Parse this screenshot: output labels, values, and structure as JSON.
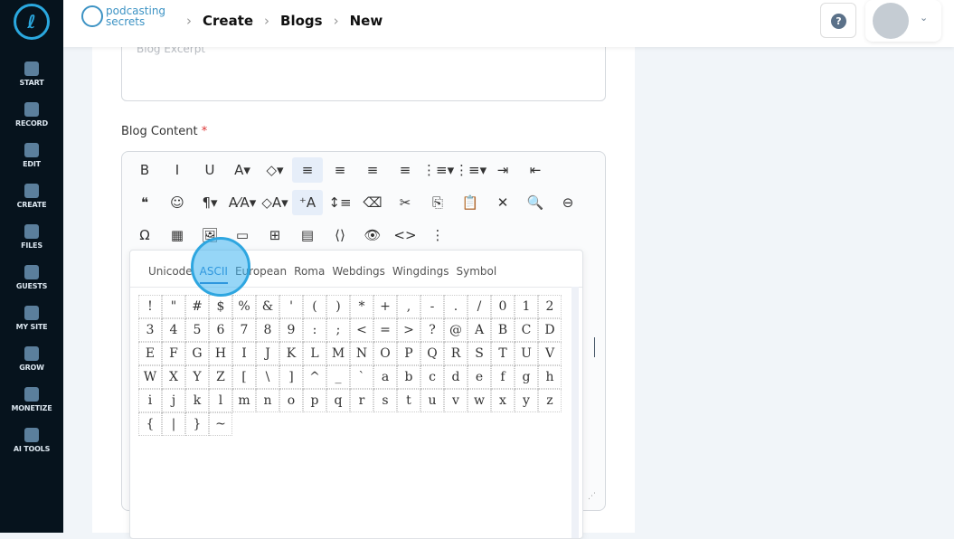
{
  "sidebar": {
    "items": [
      {
        "label": "START"
      },
      {
        "label": "RECORD"
      },
      {
        "label": "EDIT"
      },
      {
        "label": "CREATE"
      },
      {
        "label": "FILES"
      },
      {
        "label": "GUESTS"
      },
      {
        "label": "MY SITE"
      },
      {
        "label": "GROW"
      },
      {
        "label": "MONETIZE"
      },
      {
        "label": "AI TOOLS"
      }
    ]
  },
  "header": {
    "brand_line1": "podcasting",
    "brand_line2": "secrets",
    "breadcrumb": [
      "Create",
      "Blogs",
      "New"
    ],
    "help": "?"
  },
  "form": {
    "excerpt_placeholder": "Blog Excerpt",
    "content_label": "Blog Content",
    "required": "*"
  },
  "toolbar": {
    "row1": [
      "B",
      "I",
      "U",
      "A▾",
      "◇▾",
      "≡",
      "≡",
      "≡",
      "≡",
      "⋮≡▾",
      "⋮≡▾",
      "⇥",
      "⇤"
    ],
    "row2": [
      "❝",
      "☺",
      "¶▾",
      "A⁄A▾",
      "◇A▾",
      "⁺A",
      "↕≡",
      "⌫",
      "✂",
      "⎘",
      "📋",
      "✕",
      "🔍",
      "⊖"
    ],
    "row3": [
      "Ω",
      "▦",
      "🖼",
      "▭",
      "⊞",
      "▤",
      "⟨⟩",
      "👁",
      "<>",
      "⋮"
    ]
  },
  "charmap": {
    "tabs": [
      "Unicode",
      "ASCII",
      "European",
      "Roma",
      "Webdings",
      "Wingdings",
      "Symbol"
    ],
    "active_tab": "ASCII",
    "chars": [
      "!",
      "\"",
      "#",
      "$",
      "%",
      "&",
      "'",
      "(",
      ")",
      "*",
      "+",
      ",",
      "-",
      ".",
      "/",
      "0",
      "1",
      "2",
      "3",
      "4",
      "5",
      "6",
      "7",
      "8",
      "9",
      ":",
      ";",
      "<",
      "=",
      ">",
      "?",
      "@",
      "A",
      "B",
      "C",
      "D",
      "E",
      "F",
      "G",
      "H",
      "I",
      "J",
      "K",
      "L",
      "M",
      "N",
      "O",
      "P",
      "Q",
      "R",
      "S",
      "T",
      "U",
      "V",
      "W",
      "X",
      "Y",
      "Z",
      "[",
      "\\",
      "]",
      "^",
      "_",
      "`",
      "a",
      "b",
      "c",
      "d",
      "e",
      "f",
      "g",
      "h",
      "i",
      "j",
      "k",
      "l",
      "m",
      "n",
      "o",
      "p",
      "q",
      "r",
      "s",
      "t",
      "u",
      "v",
      "w",
      "x",
      "y",
      "z",
      "{",
      "|",
      "}",
      "~"
    ]
  }
}
